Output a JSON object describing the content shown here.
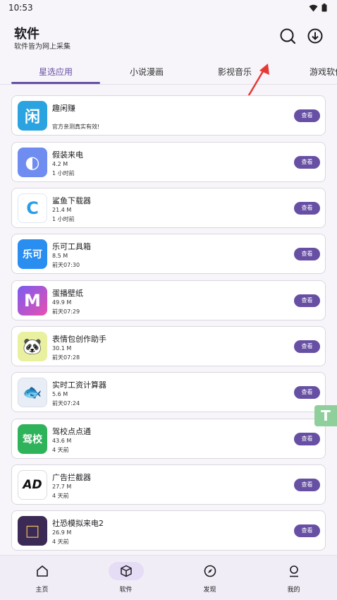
{
  "status_bar": {
    "time": "10:53"
  },
  "header": {
    "title": "软件",
    "subtitle": "软件皆为网上采集"
  },
  "tabs": [
    {
      "label": "星选应用",
      "active": true
    },
    {
      "label": "小说漫画"
    },
    {
      "label": "影视音乐"
    },
    {
      "label": "游戏软件"
    }
  ],
  "apps": [
    {
      "name": "趣闲赚",
      "note": "官方亲测真实有效!",
      "icon_text": "闲",
      "icon_bg": "#2aa3e0",
      "button": "查看"
    },
    {
      "name": "假装来电",
      "size": "4.2 M",
      "time": "1 小时前",
      "icon_text": "◐",
      "icon_bg": "#6f8df0",
      "button": "查看"
    },
    {
      "name": "鲨鱼下载器",
      "size": "21.4 M",
      "time": "1 小时前",
      "icon_text": "C",
      "icon_bg": "#2a9ee6",
      "button": "查看"
    },
    {
      "name": "乐可工具箱",
      "size": "8.5 M",
      "time": "前天07:30",
      "icon_text": "乐可",
      "icon_bg": "#2a8ef0",
      "button": "查看"
    },
    {
      "name": "蛋播壁纸",
      "size": "49.9 M",
      "time": "前天07:29",
      "icon_text": "M",
      "icon_bg": "#b050e8",
      "button": "查看"
    },
    {
      "name": "表情包创作助手",
      "size": "30.1 M",
      "time": "前天07:28",
      "icon_text": "🐼",
      "icon_bg": "#e9f0a0",
      "button": "查看"
    },
    {
      "name": "实时工资计算器",
      "size": "5.6 M",
      "time": "前天07:24",
      "icon_text": "🐟",
      "icon_bg": "#e9eef6",
      "button": "查看"
    },
    {
      "name": "驾校点点通",
      "size": "43.6 M",
      "time": "4 天前",
      "icon_text": "驾校",
      "icon_bg": "#2fb35a",
      "button": "查看"
    },
    {
      "name": "广告拦截器",
      "size": "27.7 M",
      "time": "4 天前",
      "icon_text": "AD",
      "icon_bg": "#ffffff",
      "button": "查看"
    },
    {
      "name": "社恐模拟来电2",
      "size": "26.9 M",
      "time": "4 天前",
      "icon_text": "□",
      "icon_bg": "#3b2a55",
      "button": "查看"
    }
  ],
  "float_button": {
    "label": "T"
  },
  "bottom_nav": [
    {
      "label": "主页",
      "icon": "home-icon"
    },
    {
      "label": "软件",
      "icon": "cube-icon",
      "active": true
    },
    {
      "label": "发现",
      "icon": "compass-icon"
    },
    {
      "label": "我的",
      "icon": "person-icon"
    }
  ],
  "colors": {
    "accent": "#6750a4",
    "arrow": "#e53935"
  }
}
